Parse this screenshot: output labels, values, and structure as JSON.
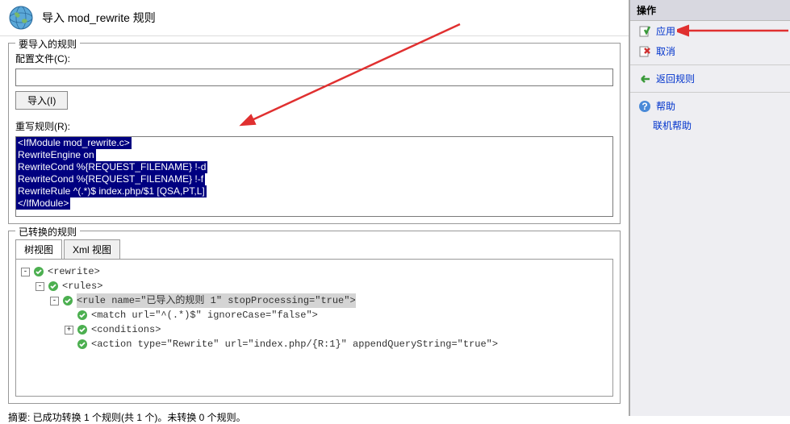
{
  "header": {
    "title": "导入 mod_rewrite 规则"
  },
  "import_section": {
    "legend": "要导入的规则",
    "config_label": "配置文件(C):",
    "config_value": "",
    "import_btn": "导入(I)",
    "rewrite_label": "重写规则(R):",
    "rewrite_lines": [
      "<IfModule mod_rewrite.c>",
      "RewriteEngine on",
      "RewriteCond %{REQUEST_FILENAME} !-d",
      "RewriteCond %{REQUEST_FILENAME} !-f",
      "RewriteRule ^(.*)$ index.php/$1 [QSA,PT,L]",
      "</IfModule>"
    ]
  },
  "converted_section": {
    "legend": "已转换的规则",
    "tabs": {
      "tree": "树视图",
      "xml": "Xml 视图"
    },
    "tree": {
      "rewrite": "<rewrite>",
      "rules": "<rules>",
      "rule": "<rule name=\"已导入的规则 1\" stopProcessing=\"true\">",
      "match": "<match url=\"^(.*)$\" ignoreCase=\"false\">",
      "conditions": "<conditions>",
      "action": "<action type=\"Rewrite\" url=\"index.php/{R:1}\" appendQueryString=\"true\">"
    },
    "summary": "摘要: 已成功转换 1 个规则(共 1 个)。未转换 0 个规则。"
  },
  "side": {
    "header": "操作",
    "apply": "应用",
    "cancel": "取消",
    "back": "返回规则",
    "help": "帮助",
    "online_help": "联机帮助"
  }
}
